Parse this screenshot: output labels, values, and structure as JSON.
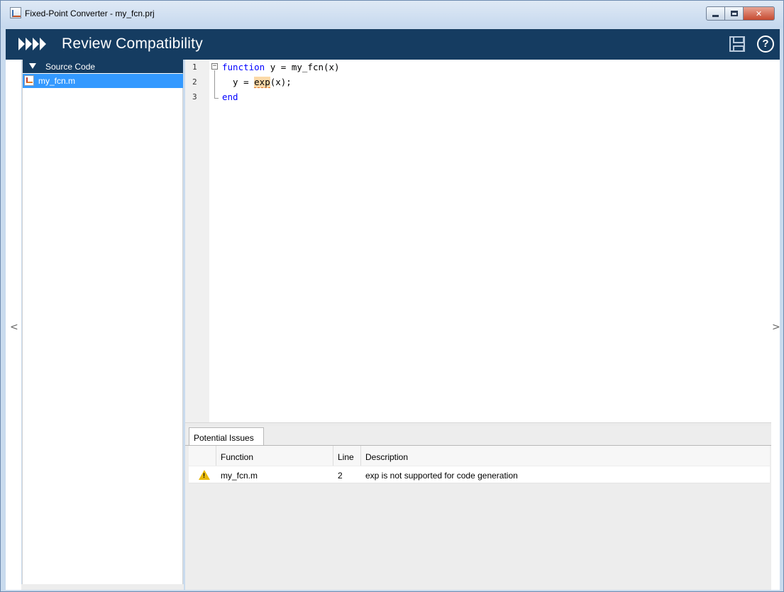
{
  "window": {
    "title": "Fixed-Point Converter - my_fcn.prj",
    "minimize_label": "",
    "maximize_label": "",
    "close_label": "✕"
  },
  "header": {
    "title": "Review Compatibility",
    "save_icon": "save-icon",
    "help_icon": "help-icon",
    "help_glyph": "?"
  },
  "left_panel": {
    "section_label": "Source Code",
    "files": [
      {
        "label": "my_fcn.m",
        "selected": true
      }
    ]
  },
  "nav": {
    "left_arrow": "<",
    "right_arrow": ">"
  },
  "editor": {
    "lines": [
      {
        "number": "1",
        "keyword": "function",
        "rest": " y = my_fcn(x)"
      },
      {
        "number": "2",
        "prefix": "  y = ",
        "highlight": "exp",
        "rest": "(x);"
      },
      {
        "number": "3",
        "keyword": "end"
      }
    ],
    "fold_glyph": "−"
  },
  "issues": {
    "tab_label": "Potential Issues",
    "columns": [
      "Function",
      "Line",
      "Description"
    ],
    "rows": [
      {
        "icon": "warning-icon",
        "function": "my_fcn.m",
        "line": "2",
        "description": "exp is not supported for code generation"
      }
    ]
  },
  "colors": {
    "header_bg": "#153c61",
    "selection": "#3399ff",
    "keyword": "#0000ff",
    "highlight": "#fbd9a8",
    "warning": "#e8b90a"
  }
}
